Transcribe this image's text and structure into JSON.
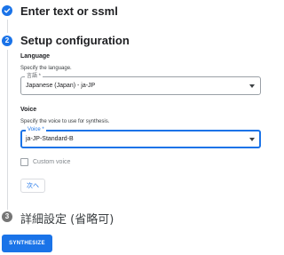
{
  "steps": [
    {
      "number": "1",
      "title": "Enter text or ssml",
      "state": "done"
    },
    {
      "number": "2",
      "title": "Setup configuration",
      "state": "active"
    },
    {
      "number": "3",
      "title": "詳細設定 (省略可)",
      "state": "pending"
    }
  ],
  "language": {
    "section_label": "Language",
    "helper": "Specify the language.",
    "field_label": "言語 *",
    "value": "Japanese (Japan) - ja-JP"
  },
  "voice": {
    "section_label": "Voice",
    "helper": "Specify the voice to use for synthesis.",
    "field_label": "Voice *",
    "value": "ja-JP-Standard-B"
  },
  "custom_voice": {
    "label": "Custom voice",
    "checked": false
  },
  "next_button_label": "次へ",
  "synthesize_button_label": "SYNTHESIZE",
  "colors": {
    "accent": "#1a73e8",
    "pending_step": "#757575"
  }
}
